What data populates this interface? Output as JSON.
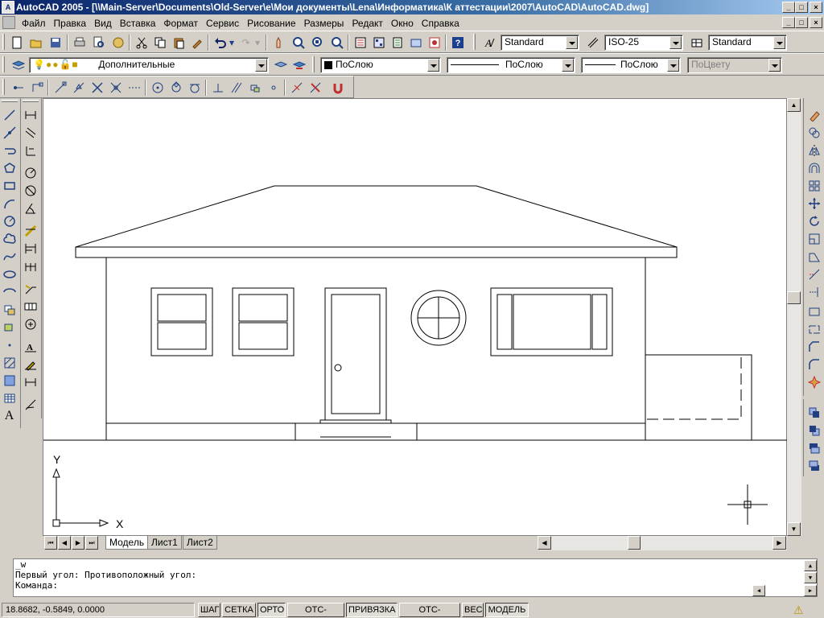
{
  "window": {
    "icon_label": "A",
    "title": "AutoCAD 2005 - [\\\\Main-Server\\Documents\\Old-Server\\e\\Мои документы\\Lena\\Информатика\\К аттестации\\2007\\AutoCAD\\AutoCAD.dwg]",
    "min": "_",
    "max": "□",
    "close": "×"
  },
  "menu": {
    "items": [
      "Файл",
      "Правка",
      "Вид",
      "Вставка",
      "Формат",
      "Сервис",
      "Рисование",
      "Размеры",
      "Редакт",
      "Окно",
      "Справка"
    ]
  },
  "styles": {
    "text_style": "Standard",
    "dim_style": "ISO-25",
    "table_style": "Standard"
  },
  "layers": {
    "current_layer": "Дополнительные",
    "color": "ПоСлою",
    "linetype": "ПоСлою",
    "lineweight": "ПоСлою",
    "plotstyle": "ПоЦвету"
  },
  "tabs": {
    "model": "Модель",
    "sheet1": "Лист1",
    "sheet2": "Лист2"
  },
  "ucs": {
    "x_label": "X",
    "y_label": "Y"
  },
  "command": {
    "line1": "_w",
    "line2": "Первый угол: Противоположный угол:",
    "prompt": "Команда:"
  },
  "status": {
    "coords": "18.8682, -0.5849, 0.0000",
    "buttons": [
      "ШАГ",
      "СЕТКА",
      "ОРТО",
      "ОТС-ПОЛЯР",
      "ПРИВЯЗКА",
      "ОТС-ОБЪЕКТ",
      "ВЕС",
      "МОДЕЛЬ"
    ],
    "pressed": [
      "ОРТО",
      "ПРИВЯЗКА",
      "МОДЕЛЬ"
    ]
  },
  "colors": {
    "title_bar": "#0a246a",
    "face": "#d4d0c8",
    "canvas": "#ffffff"
  }
}
